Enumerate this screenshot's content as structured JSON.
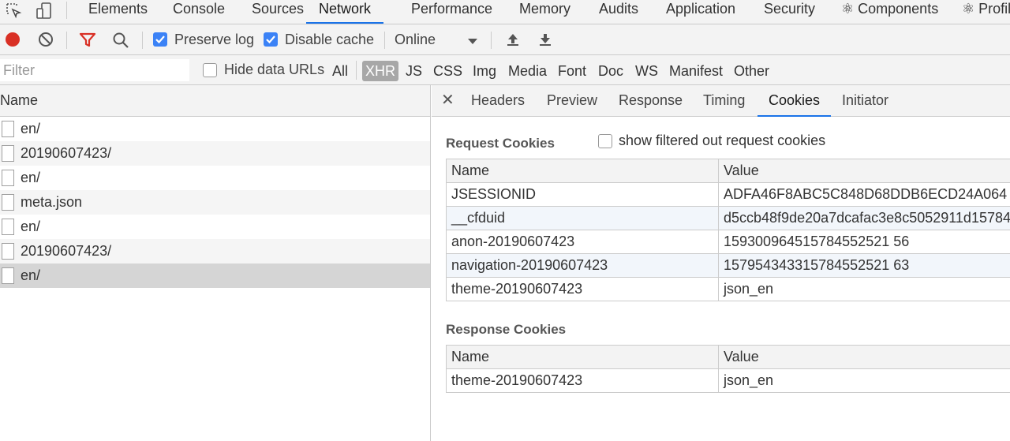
{
  "devtools_tabs": [
    {
      "label": "Elements"
    },
    {
      "label": "Console"
    },
    {
      "label": "Sources"
    },
    {
      "label": "Network"
    },
    {
      "label": "Performance"
    },
    {
      "label": "Memory"
    },
    {
      "label": "Audits"
    },
    {
      "label": "Application"
    },
    {
      "label": "Security"
    },
    {
      "label": "⚛ Components"
    },
    {
      "label": "⚛ Profile"
    }
  ],
  "active_tab": "Network",
  "toolbar": {
    "preserve_log_label": "Preserve log",
    "preserve_log_checked": true,
    "disable_cache_label": "Disable cache",
    "disable_cache_checked": true,
    "throttling_value": "Online"
  },
  "filter": {
    "placeholder": "Filter",
    "value": "",
    "hide_data_urls_label": "Hide data URLs",
    "types": [
      "All",
      "XHR",
      "JS",
      "CSS",
      "Img",
      "Media",
      "Font",
      "Doc",
      "WS",
      "Manifest",
      "Other"
    ],
    "active_type": "XHR"
  },
  "requests": {
    "header": "Name",
    "items": [
      {
        "name": "en/"
      },
      {
        "name": "20190607423/"
      },
      {
        "name": "en/"
      },
      {
        "name": "meta.json"
      },
      {
        "name": "en/"
      },
      {
        "name": "20190607423/"
      },
      {
        "name": "en/"
      }
    ],
    "selected_index": 6
  },
  "detail_tabs": [
    "Headers",
    "Preview",
    "Response",
    "Timing",
    "Cookies",
    "Initiator"
  ],
  "active_detail_tab": "Cookies",
  "request_cookies": {
    "title": "Request Cookies",
    "show_filtered_label": "show filtered out request cookies",
    "columns": [
      "Name",
      "Value"
    ],
    "rows": [
      {
        "name": "JSESSIONID",
        "value": "ADFA46F8ABC5C848D68DDB6ECD24A064"
      },
      {
        "name": "__cfduid",
        "value": "d5ccb48f9de20a7dcafac3e8c5052911d15784"
      },
      {
        "name": "anon-20190607423",
        "value": "159300964515784552521 56"
      },
      {
        "name": "navigation-20190607423",
        "value": "157954343315784552521 63"
      },
      {
        "name": "theme-20190607423",
        "value": "json_en"
      }
    ]
  },
  "response_cookies": {
    "title": "Response Cookies",
    "columns": [
      "Name",
      "Value"
    ],
    "rows": [
      {
        "name": "theme-20190607423",
        "value": "json_en"
      }
    ]
  },
  "colors": {
    "accent": "#1a73e8",
    "record": "#d93025",
    "filter_icon": "#d93025",
    "checkbox": "#3b82f6"
  }
}
